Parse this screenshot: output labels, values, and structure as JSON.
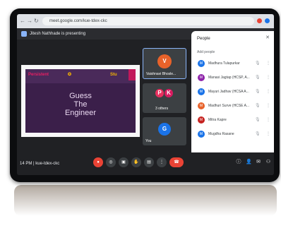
{
  "browser": {
    "url": "meet.google.com/kue-tdex-ckc",
    "nav_back": "←",
    "nav_forward": "→",
    "nav_reload": "↻"
  },
  "meet": {
    "presenting_text": "Jitesh Nathhade is presenting"
  },
  "slide": {
    "title_line1": "Guess",
    "title_line2": "The",
    "title_line3": "Engineer",
    "logo_left": "Persistent",
    "logo_mid": "✪",
    "logo_right": "Stu"
  },
  "tiles": [
    {
      "initial": "V",
      "name": "Vaishnavi Bhosle...",
      "color": "#e8622a"
    },
    {
      "initial_a": "P",
      "initial_b": "K",
      "name": "3 others",
      "color_a": "#e8305f",
      "color_b": "#d81b60"
    },
    {
      "initial": "G",
      "name": "You",
      "color": "#1a73e8"
    }
  ],
  "people": {
    "title": "People",
    "close": "✕",
    "add_label": "Add people",
    "list": [
      {
        "initial": "M",
        "name": "Madhura Tulapurkar",
        "color": "#1a73e8"
      },
      {
        "initial": "M",
        "name": "Manasi Jagtap (HCSP, A...",
        "color": "#8e24aa"
      },
      {
        "initial": "M",
        "name": "Mayuri Jadhav (HCSA A...",
        "color": "#1a73e8"
      },
      {
        "initial": "M",
        "name": "Madhuri Surve (HCSE A...",
        "color": "#e8622a"
      },
      {
        "initial": "M",
        "name": "Mitra Kapre",
        "color": "#c5221f"
      },
      {
        "initial": "M",
        "name": "Mugdha Rasane",
        "color": "#1a73e8"
      }
    ]
  },
  "controls": {
    "time": "14 PM  |  kue-tdex-ckc",
    "buttons": [
      "●",
      "◎",
      "▣",
      "✋",
      "▤",
      "⋮",
      "☎"
    ],
    "right": [
      "ⓘ",
      "👤",
      "✉",
      "⚇"
    ]
  }
}
